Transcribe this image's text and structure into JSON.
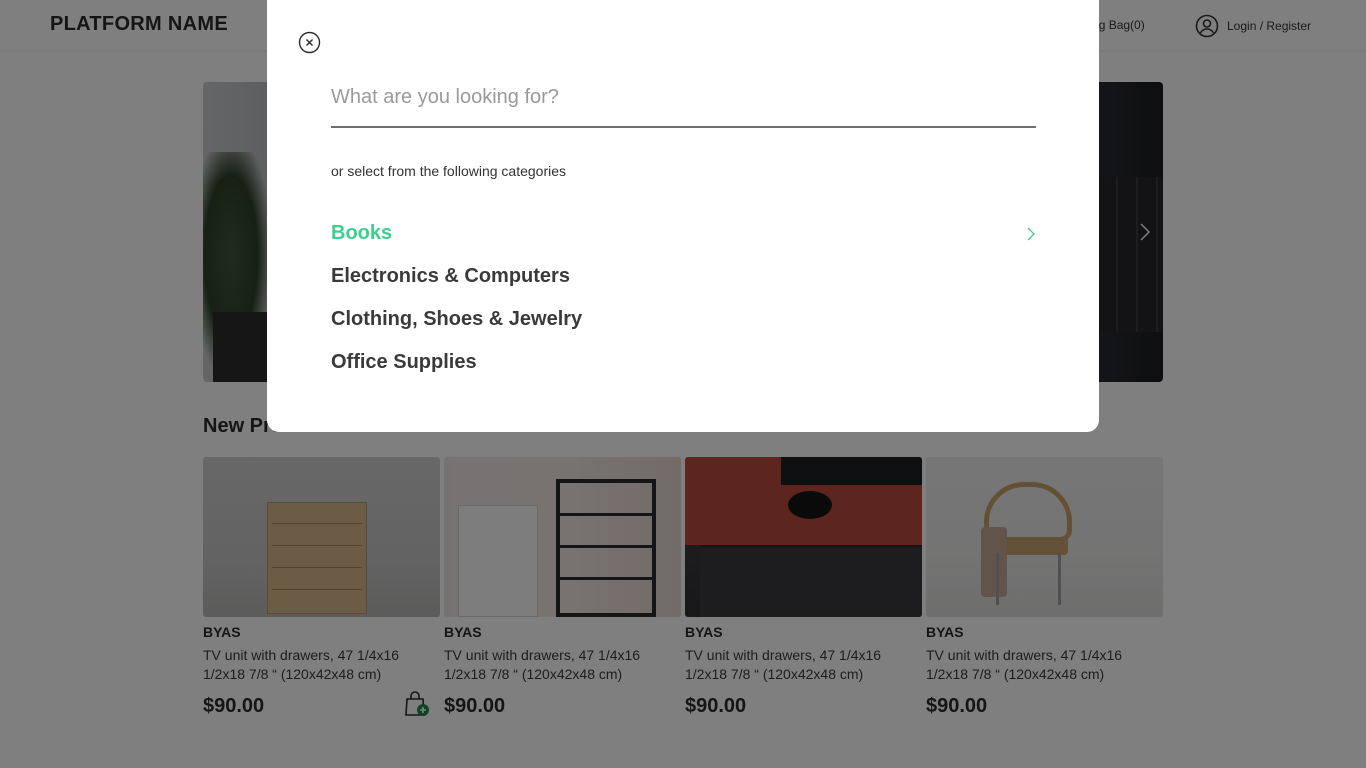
{
  "header": {
    "brand": "PLATFORM NAME",
    "bag_label": "pping Bag(0)",
    "login_label": "Login / Register"
  },
  "hero": {
    "next_icon": "chevron-right-icon"
  },
  "products": {
    "section_title": "New Products",
    "items": [
      {
        "brand": "BYAS",
        "desc": "TV unit with drawers, 47 1/4x16 1/2x18 7/8 “ (120x42x48 cm)",
        "price": "$90.00"
      },
      {
        "brand": "BYAS",
        "desc": "TV unit with drawers, 47 1/4x16 1/2x18 7/8 “ (120x42x48 cm)",
        "price": "$90.00"
      },
      {
        "brand": "BYAS",
        "desc": "TV unit with drawers, 47 1/4x16 1/2x18 7/8 “ (120x42x48 cm)",
        "price": "$90.00"
      },
      {
        "brand": "BYAS",
        "desc": "TV unit with drawers, 47 1/4x16 1/2x18 7/8 “ (120x42x48 cm)",
        "price": "$90.00"
      }
    ]
  },
  "search_modal": {
    "placeholder": "What are you looking for?",
    "hint": "or select from the following categories",
    "categories": [
      {
        "label": "Books",
        "active": true
      },
      {
        "label": "Electronics & Computers",
        "active": false
      },
      {
        "label": "Clothing, Shoes & Jewelry",
        "active": false
      },
      {
        "label": "Office Supplies",
        "active": false
      }
    ],
    "accent_color": "#3ccf8e"
  }
}
